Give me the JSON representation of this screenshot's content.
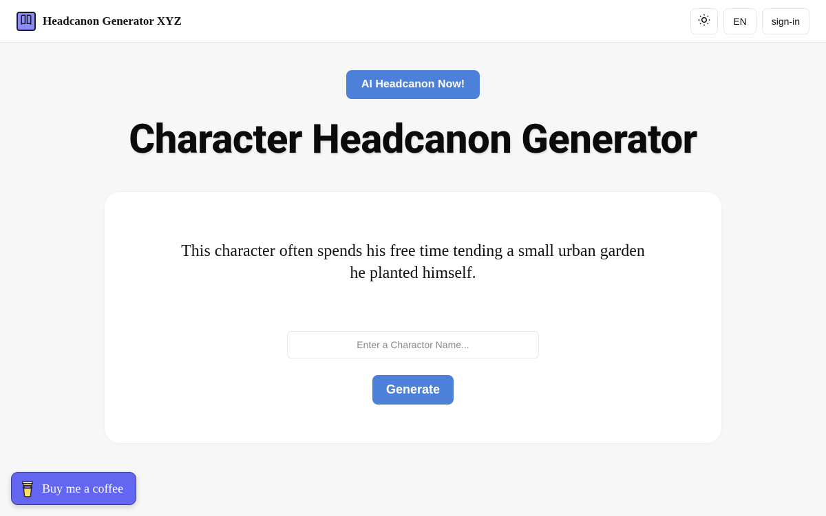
{
  "header": {
    "app_title": "Headcanon Generator XYZ",
    "lang_label": "EN",
    "signin_label": "sign-in"
  },
  "hero": {
    "cta_label": "AI Headcanon Now!",
    "page_title": "Character Headcanon Generator"
  },
  "card": {
    "headcanon_text": "This character often spends his free time tending a small urban garden he planted himself.",
    "input_placeholder": "Enter a Charactor Name...",
    "generate_label": "Generate"
  },
  "coffee": {
    "label": "Buy me a coffee"
  }
}
